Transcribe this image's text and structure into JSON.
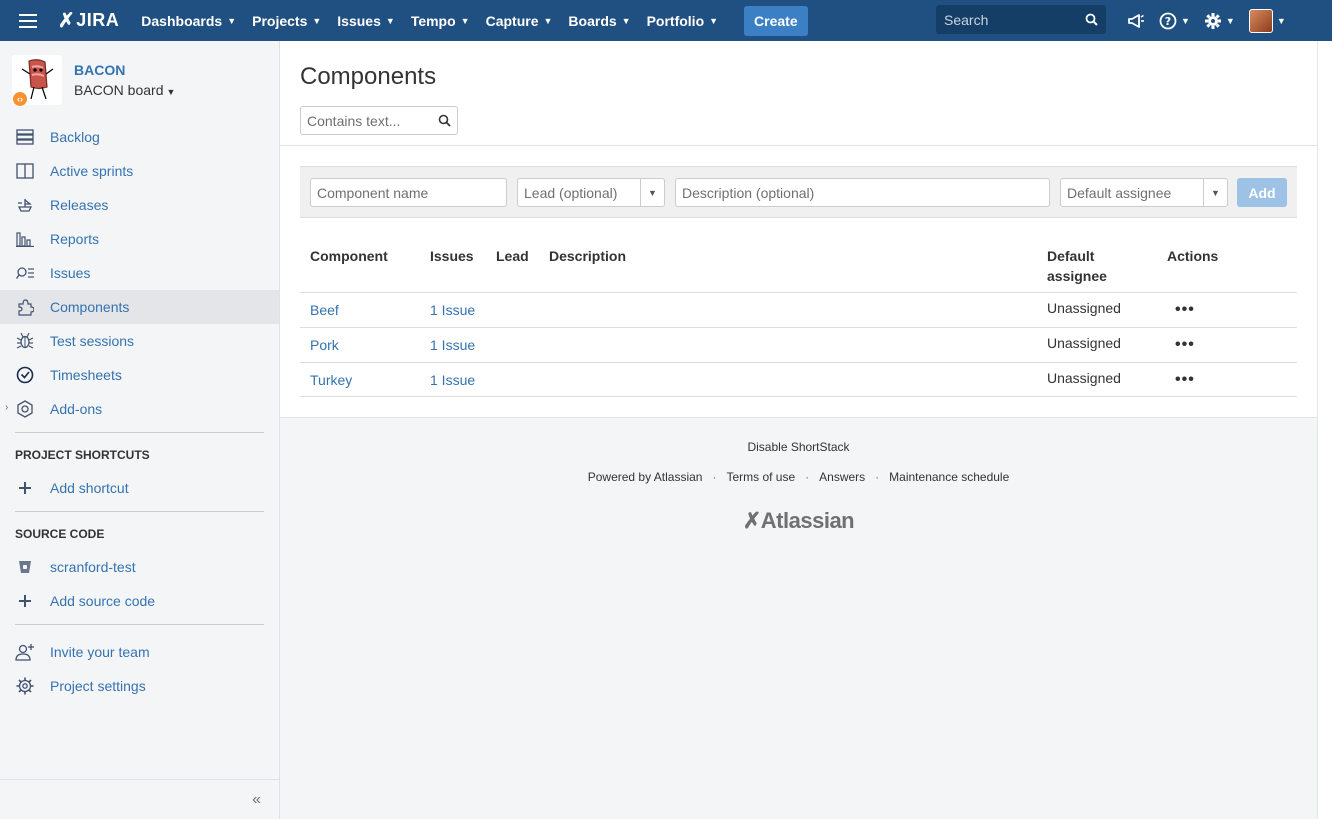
{
  "topnav": {
    "logo": "JIRA",
    "items": [
      {
        "label": "Dashboards"
      },
      {
        "label": "Projects"
      },
      {
        "label": "Issues"
      },
      {
        "label": "Tempo"
      },
      {
        "label": "Capture"
      },
      {
        "label": "Boards"
      },
      {
        "label": "Portfolio"
      }
    ],
    "create_label": "Create",
    "search_placeholder": "Search"
  },
  "sidebar": {
    "project_name": "BACON",
    "board_name": "BACON board",
    "items": [
      {
        "label": "Backlog"
      },
      {
        "label": "Active sprints"
      },
      {
        "label": "Releases"
      },
      {
        "label": "Reports"
      },
      {
        "label": "Issues"
      },
      {
        "label": "Components"
      },
      {
        "label": "Test sessions"
      },
      {
        "label": "Timesheets"
      },
      {
        "label": "Add-ons"
      }
    ],
    "shortcuts_title": "PROJECT SHORTCUTS",
    "add_shortcut": "Add shortcut",
    "source_title": "SOURCE CODE",
    "repo": "scranford-test",
    "add_source": "Add source code",
    "invite": "Invite your team",
    "settings": "Project settings"
  },
  "main": {
    "title": "Components",
    "filter_placeholder": "Contains text...",
    "form": {
      "name_placeholder": "Component name",
      "lead_placeholder": "Lead (optional)",
      "desc_placeholder": "Description (optional)",
      "assignee_placeholder": "Default assignee",
      "add_label": "Add"
    },
    "columns": {
      "component": "Component",
      "issues": "Issues",
      "lead": "Lead",
      "description": "Description",
      "default_assignee_1": "Default",
      "default_assignee_2": "assignee",
      "actions": "Actions"
    },
    "rows": [
      {
        "component": "Beef",
        "issues": "1 Issue",
        "assignee": "Unassigned",
        "actions": "•••"
      },
      {
        "component": "Pork",
        "issues": "1 Issue",
        "assignee": "Unassigned",
        "actions": "•••"
      },
      {
        "component": "Turkey",
        "issues": "1 Issue",
        "assignee": "Unassigned",
        "actions": "•••"
      }
    ]
  },
  "footer": {
    "disable": "Disable ShortStack",
    "powered": "Powered by Atlassian",
    "terms": "Terms of use",
    "answers": "Answers",
    "maintenance": "Maintenance schedule",
    "dot": "·",
    "logo": "Atlassian"
  },
  "colors": {
    "topbar": "#205081",
    "link": "#3572b0",
    "create": "#3b7fc4",
    "add_disabled": "#9ec1e6"
  }
}
